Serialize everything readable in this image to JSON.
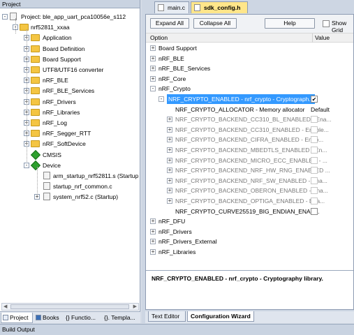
{
  "project_pane": {
    "title": "Project",
    "root": "Project: ble_app_uart_pca10056e_s112",
    "target": "nrf52811_xxaa",
    "groups": [
      "Application",
      "Board Definition",
      "Board Support",
      "UTF8/UTF16 converter",
      "nRF_BLE",
      "nRF_BLE_Services",
      "nRF_Drivers",
      "nRF_Libraries",
      "nRF_Log",
      "nRF_Segger_RTT",
      "nRF_SoftDevice"
    ],
    "cmsis": "CMSIS",
    "device": "Device",
    "device_files": [
      "arm_startup_nrf52811.s (Startup",
      "startup_nrf_common.c",
      "system_nrf52.c (Startup)"
    ],
    "tabs": [
      "Project",
      "Books",
      "{} Functio...",
      "{}. Templa..."
    ]
  },
  "editor": {
    "tabs": [
      "main.c",
      "sdk_config.h"
    ],
    "active_tab": "sdk_config.h",
    "toolbar": {
      "expand_all": "Expand All",
      "collapse_all": "Collapse All",
      "help": "Help",
      "show_grid": "Show Grid"
    },
    "columns": {
      "option": "Option",
      "value": "Value"
    },
    "options": [
      {
        "label": "Board Support",
        "level": 0,
        "expander": "+"
      },
      {
        "label": "nRF_BLE",
        "level": 0,
        "expander": "+"
      },
      {
        "label": "nRF_BLE_Services",
        "level": 0,
        "expander": "+"
      },
      {
        "label": "nRF_Core",
        "level": 0,
        "expander": "+"
      },
      {
        "label": "nRF_Crypto",
        "level": 0,
        "expander": "-"
      },
      {
        "label": "NRF_CRYPTO_ENABLED - nrf_crypto - Cryptograph...",
        "level": 1,
        "expander": "-",
        "selected": true,
        "checkbox": "checked"
      },
      {
        "label": "NRF_CRYPTO_ALLOCATOR  - Memory allocator",
        "level": 2,
        "value": "Default"
      },
      {
        "label": "NRF_CRYPTO_BACKEND_CC310_BL_ENABLED - Ena...",
        "level": 2,
        "expander": "+",
        "checkbox": "empty",
        "disabled": true
      },
      {
        "label": "NRF_CRYPTO_BACKEND_CC310_ENABLED - Enable...",
        "level": 2,
        "expander": "+",
        "checkbox": "empty",
        "disabled": true
      },
      {
        "label": "NRF_CRYPTO_BACKEND_CIFRA_ENABLED - Enab...",
        "level": 2,
        "expander": "+",
        "checkbox": "empty",
        "disabled": true
      },
      {
        "label": "NRF_CRYPTO_BACKEND_MBEDTLS_ENABLED - En...",
        "level": 2,
        "expander": "+",
        "checkbox": "empty",
        "disabled": true
      },
      {
        "label": "NRF_CRYPTO_BACKEND_MICRO_ECC_ENABLED - ...",
        "level": 2,
        "expander": "+",
        "checkbox": "empty",
        "disabled": true
      },
      {
        "label": "NRF_CRYPTO_BACKEND_NRF_HW_RNG_ENABLED ...",
        "level": 2,
        "expander": "+",
        "checkbox": "empty",
        "disabled": true
      },
      {
        "label": "NRF_CRYPTO_BACKEND_NRF_SW_ENABLED - Ena...",
        "level": 2,
        "expander": "+",
        "checkbox": "empty",
        "disabled": true
      },
      {
        "label": "NRF_CRYPTO_BACKEND_OBERON_ENABLED - Ena...",
        "level": 2,
        "expander": "+",
        "checkbox": "empty",
        "disabled": true
      },
      {
        "label": "NRF_CRYPTO_BACKEND_OPTIGA_ENABLED - Ena...",
        "level": 2,
        "expander": "+",
        "checkbox": "empty",
        "disabled": true
      },
      {
        "label": "NRF_CRYPTO_CURVE25519_BIG_ENDIAN_ENAB...",
        "level": 2,
        "checkbox": "empty"
      },
      {
        "label": "nRF_DFU",
        "level": 0,
        "expander": "+"
      },
      {
        "label": "nRF_Drivers",
        "level": 0,
        "expander": "+"
      },
      {
        "label": "nRF_Drivers_External",
        "level": 0,
        "expander": "+"
      },
      {
        "label": "nRF_Libraries",
        "level": 0,
        "expander": "+"
      }
    ],
    "description": "NRF_CRYPTO_ENABLED - nrf_crypto - Cryptography library.",
    "bottom_tabs": [
      "Text Editor",
      "Configuration Wizard"
    ],
    "active_bottom_tab": "Configuration Wizard"
  },
  "status_bar": "Build Output",
  "colors": {
    "selection": "#3399ff",
    "folder": "#f4c542",
    "active_tab": "#ffe68a"
  }
}
